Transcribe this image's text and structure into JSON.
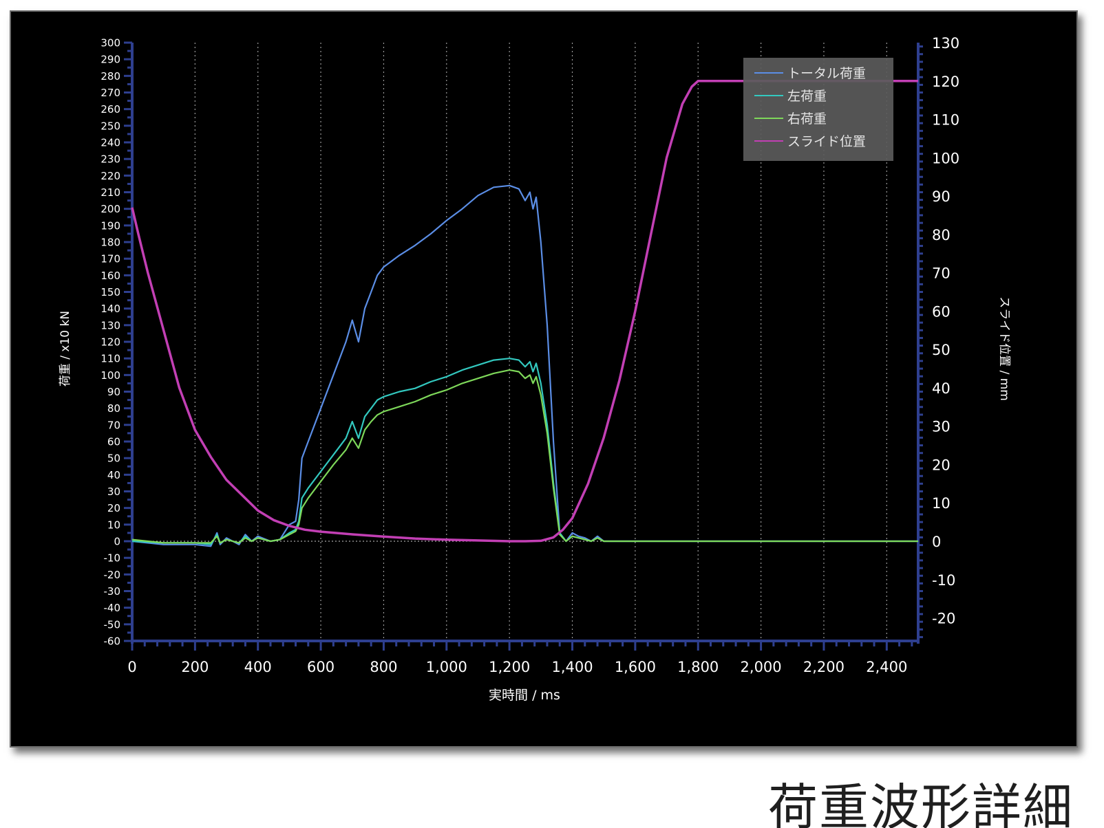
{
  "caption": "荷重波形詳細",
  "chart_data": {
    "type": "line",
    "xlabel": "実時間 / ms",
    "ylabel_left": "荷重 / x10 kN",
    "ylabel_right": "スライド位置 / mm",
    "xlim": [
      0,
      2500
    ],
    "x_ticks": [
      0,
      200,
      400,
      600,
      800,
      1000,
      1200,
      1400,
      1600,
      1800,
      2000,
      2200,
      2400
    ],
    "x_tick_labels": [
      "0",
      "200",
      "400",
      "600",
      "800",
      "1,000",
      "1,200",
      "1,400",
      "1,600",
      "1,800",
      "2,000",
      "2,200",
      "2,400"
    ],
    "ylim_left": [
      -60,
      300
    ],
    "y_ticks_left": [
      300,
      290,
      280,
      270,
      260,
      250,
      240,
      230,
      220,
      210,
      200,
      190,
      180,
      170,
      160,
      150,
      140,
      130,
      120,
      110,
      100,
      90,
      80,
      70,
      60,
      50,
      40,
      30,
      20,
      10,
      0,
      -10,
      -20,
      -30,
      -40,
      -50,
      -60
    ],
    "ylim_right": [
      -26,
      130
    ],
    "y_ticks_right": [
      130,
      120,
      110,
      100,
      90,
      80,
      70,
      60,
      50,
      40,
      30,
      20,
      10,
      0,
      -10,
      -20
    ],
    "grid": "vertical dotted",
    "legend_position": "top-right",
    "colors": {
      "background": "#000000",
      "axis": "#2e3f8f",
      "tick_text": "#ffffff",
      "grid": "#9a9a9a",
      "legend_bg": "#5b5b5b"
    },
    "series": [
      {
        "name": "トータル荷重",
        "axis": "left",
        "color": "#5b8ee6",
        "x": [
          0,
          100,
          200,
          250,
          270,
          280,
          300,
          340,
          360,
          380,
          400,
          440,
          470,
          500,
          520,
          530,
          540,
          560,
          600,
          640,
          680,
          700,
          720,
          740,
          760,
          780,
          800,
          850,
          900,
          950,
          1000,
          1050,
          1100,
          1150,
          1200,
          1230,
          1250,
          1265,
          1275,
          1285,
          1300,
          1320,
          1340,
          1360,
          1380,
          1400,
          1420,
          1440,
          1460,
          1480,
          1500,
          2500
        ],
        "y": [
          0,
          -2,
          -2,
          -3,
          5,
          -2,
          2,
          -2,
          4,
          0,
          3,
          0,
          1,
          10,
          12,
          25,
          50,
          60,
          80,
          100,
          120,
          133,
          120,
          140,
          150,
          160,
          165,
          172,
          178,
          185,
          193,
          200,
          208,
          213,
          214,
          212,
          205,
          210,
          200,
          207,
          180,
          130,
          60,
          5,
          0,
          5,
          3,
          2,
          0,
          3,
          0,
          0
        ]
      },
      {
        "name": "左荷重",
        "axis": "left",
        "color": "#33c9c0",
        "x": [
          0,
          100,
          200,
          250,
          270,
          280,
          300,
          340,
          360,
          380,
          400,
          440,
          470,
          500,
          520,
          530,
          540,
          560,
          600,
          640,
          680,
          700,
          720,
          740,
          760,
          780,
          800,
          850,
          900,
          950,
          1000,
          1050,
          1100,
          1150,
          1200,
          1230,
          1250,
          1265,
          1275,
          1285,
          1300,
          1320,
          1340,
          1360,
          1380,
          1400,
          1420,
          1440,
          1460,
          1480,
          1500,
          2500
        ],
        "y": [
          0,
          -1,
          -1,
          -2,
          4,
          -1,
          1,
          -1,
          3,
          0,
          2,
          0,
          1,
          5,
          7,
          12,
          26,
          32,
          42,
          52,
          62,
          72,
          62,
          75,
          80,
          85,
          87,
          90,
          92,
          96,
          99,
          103,
          106,
          109,
          110,
          109,
          105,
          108,
          102,
          107,
          95,
          70,
          35,
          5,
          0,
          3,
          2,
          1,
          0,
          2,
          0,
          0
        ]
      },
      {
        "name": "右荷重",
        "axis": "left",
        "color": "#7ed85a",
        "x": [
          0,
          100,
          200,
          250,
          270,
          280,
          300,
          340,
          360,
          380,
          400,
          440,
          470,
          500,
          520,
          530,
          540,
          560,
          600,
          640,
          680,
          700,
          720,
          740,
          760,
          780,
          800,
          850,
          900,
          950,
          1000,
          1050,
          1100,
          1150,
          1200,
          1230,
          1250,
          1265,
          1275,
          1285,
          1300,
          1320,
          1340,
          1360,
          1380,
          1400,
          1420,
          1440,
          1460,
          1480,
          1500,
          2500
        ],
        "y": [
          1,
          -1,
          -1,
          -1,
          3,
          -1,
          1,
          -1,
          2,
          0,
          2,
          0,
          1,
          4,
          6,
          10,
          20,
          26,
          36,
          46,
          55,
          62,
          56,
          67,
          72,
          76,
          78,
          81,
          84,
          88,
          91,
          95,
          98,
          101,
          103,
          102,
          98,
          100,
          95,
          99,
          88,
          65,
          32,
          4,
          0,
          3,
          2,
          1,
          0,
          2,
          0,
          0
        ]
      },
      {
        "name": "スライド位置",
        "axis": "right",
        "color": "#c23fb4",
        "x": [
          0,
          20,
          50,
          100,
          150,
          200,
          250,
          300,
          350,
          400,
          450,
          500,
          550,
          600,
          700,
          800,
          900,
          1000,
          1100,
          1200,
          1250,
          1300,
          1340,
          1370,
          1400,
          1450,
          1500,
          1550,
          1600,
          1650,
          1700,
          1750,
          1780,
          1800,
          1820,
          1850,
          1900,
          2000,
          2500
        ],
        "y": [
          87,
          80,
          70,
          55,
          40,
          29,
          22,
          16,
          12,
          8,
          5.5,
          4,
          3,
          2.5,
          1.8,
          1.2,
          0.7,
          0.4,
          0.2,
          0,
          0,
          0.1,
          1,
          3,
          6,
          15,
          27,
          42,
          60,
          80,
          100,
          114,
          118.5,
          120,
          120,
          120,
          120,
          120,
          120
        ]
      }
    ]
  }
}
